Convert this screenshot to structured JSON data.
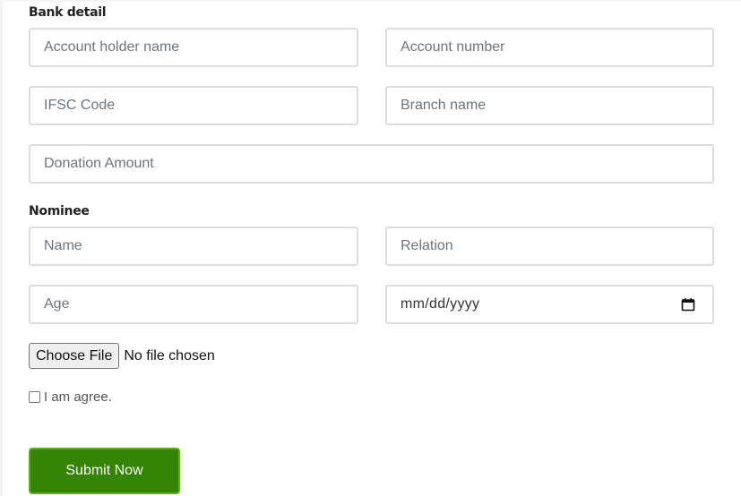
{
  "bank_detail": {
    "title": "Bank detail",
    "account_holder_name": {
      "placeholder": "Account holder name",
      "value": ""
    },
    "account_number": {
      "placeholder": "Account number",
      "value": ""
    },
    "ifsc_code": {
      "placeholder": "IFSC Code",
      "value": ""
    },
    "branch_name": {
      "placeholder": "Branch name",
      "value": ""
    },
    "donation_amount": {
      "placeholder": "Donation Amount",
      "value": ""
    }
  },
  "nominee": {
    "title": "Nominee",
    "name": {
      "placeholder": "Name",
      "value": ""
    },
    "relation": {
      "placeholder": "Relation",
      "value": ""
    },
    "age": {
      "placeholder": "Age",
      "value": ""
    },
    "date": {
      "display": "mm/dd/yyyy",
      "icon": "calendar-icon"
    }
  },
  "file_upload": {
    "button_label": "Choose File",
    "status": "No file chosen"
  },
  "agreement": {
    "label": "I am agree.",
    "checked": false
  },
  "submit": {
    "label": "Submit Now",
    "color": "#368405",
    "border_color": "#5fae1e"
  }
}
